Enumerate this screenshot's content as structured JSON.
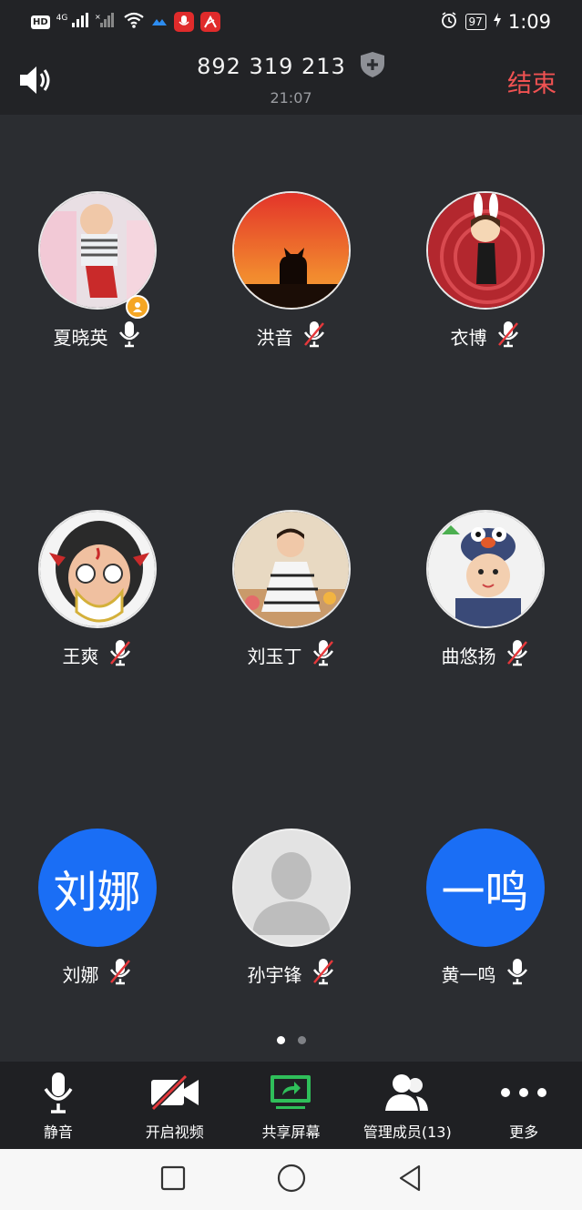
{
  "status_bar": {
    "hd": "HD",
    "net": "4G",
    "battery": "97",
    "time": "1:09"
  },
  "header": {
    "meeting_id": "892 319 213",
    "elapsed": "21:07",
    "end_label": "结束"
  },
  "participants": [
    {
      "name": "夏晓英",
      "mic": "on",
      "avatar": "photo-baby",
      "host": true
    },
    {
      "name": "洪音",
      "mic": "off",
      "avatar": "photo-sunset-cat"
    },
    {
      "name": "衣博",
      "mic": "off",
      "avatar": "photo-cartoon-girl"
    },
    {
      "name": "王爽",
      "mic": "off",
      "avatar": "photo-cartoon-mask"
    },
    {
      "name": "刘玉丁",
      "mic": "off",
      "avatar": "photo-girl-dress"
    },
    {
      "name": "曲悠扬",
      "mic": "off",
      "avatar": "photo-baby-hat"
    },
    {
      "name": "刘娜",
      "mic": "off",
      "avatar_text": "刘娜"
    },
    {
      "name": "孙宇锋",
      "mic": "off",
      "avatar": "default-silhouette"
    },
    {
      "name": "黄一鸣",
      "mic": "on",
      "avatar_text": "一鸣"
    }
  ],
  "pager": {
    "pages": 2,
    "current": 1
  },
  "toolbar": {
    "mute": "静音",
    "video": "开启视频",
    "share": "共享屏幕",
    "members": "管理成员(13)",
    "more": "更多"
  },
  "colors": {
    "accent": "#1a6ef5",
    "end": "#f05252",
    "share": "#2fbf5a",
    "muted": "#e5383b",
    "host": "#f5a623"
  }
}
